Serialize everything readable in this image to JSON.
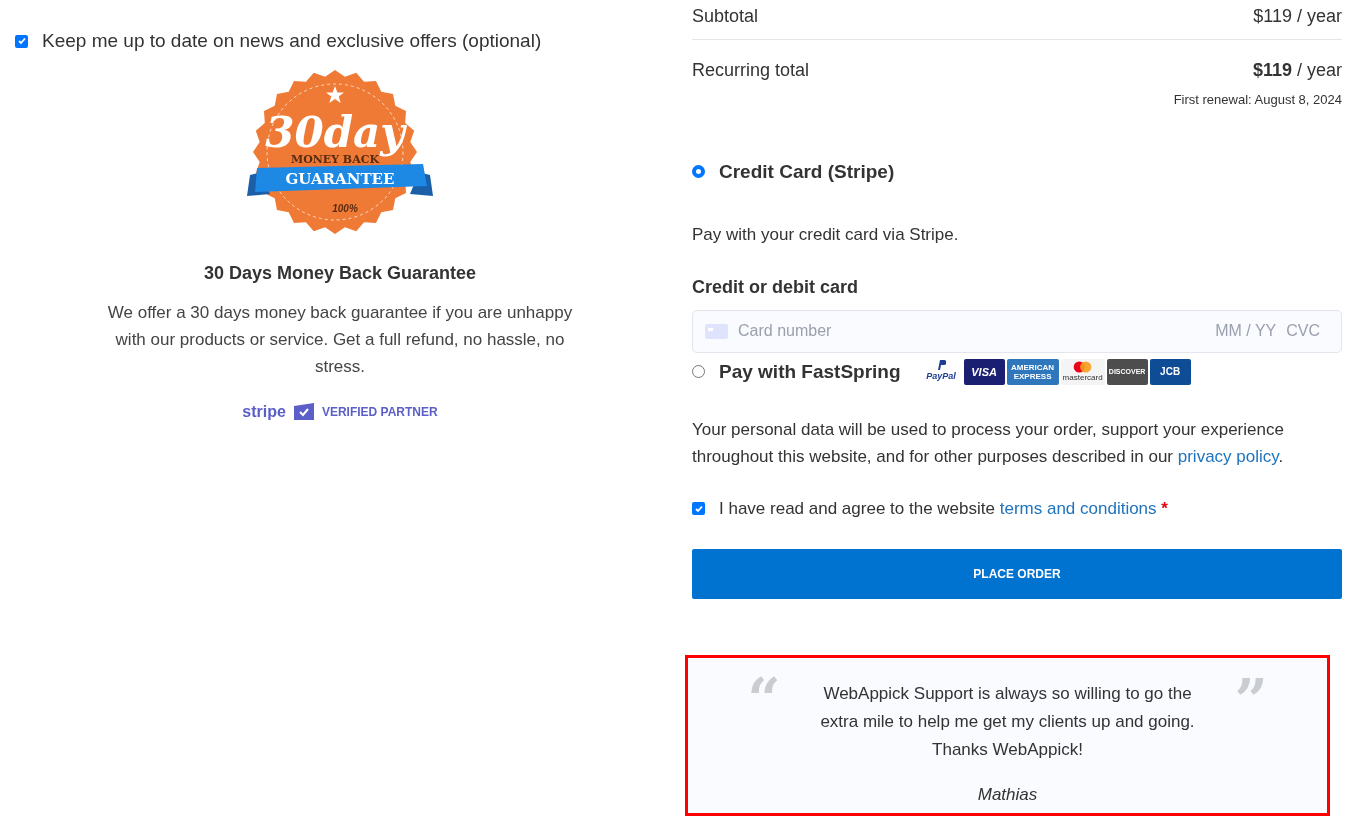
{
  "newsletter": {
    "label": "Keep me up to date on news and exclusive offers (optional)",
    "checked": true
  },
  "badge": {
    "big": "30day",
    "line": "MONEY BACK",
    "ribbon": "GUARANTEE",
    "percent": "100%"
  },
  "guarantee": {
    "title": "30 Days Money Back Guarantee",
    "text": "We offer a 30 days money back guarantee if you are unhappy with our products or service. Get a full refund, no hassle, no stress."
  },
  "stripe_badge": {
    "brand": "stripe",
    "label": "VERIFIED PARTNER"
  },
  "totals": [
    {
      "label": "Subtotal",
      "amount": "$119",
      "period": " / year",
      "bold": false
    },
    {
      "label": "Recurring total",
      "amount": "$119",
      "period": " / year",
      "bold": true
    }
  ],
  "renewal": "First renewal: August 8, 2024",
  "payment_methods": [
    {
      "kind": "stripe",
      "label": "Credit Card (Stripe)",
      "selected": true,
      "description": "Pay with your credit card via Stripe.",
      "card_heading": "Credit or debit card",
      "card_placeholder": "Card number",
      "expiry_placeholder": "MM / YY",
      "cvc_placeholder": "CVC"
    },
    {
      "kind": "fastspring",
      "label": "Pay with FastSpring",
      "selected": false,
      "logos": [
        {
          "kind": "paypal",
          "text": "PayPal"
        },
        {
          "kind": "visa",
          "text": "VISA"
        },
        {
          "kind": "amex",
          "text": "AMERICAN EXPRESS"
        },
        {
          "kind": "mastercard",
          "text": "mastercard"
        },
        {
          "kind": "discover",
          "text": "DISCOVER"
        },
        {
          "kind": "jcb",
          "text": "JCB"
        }
      ]
    }
  ],
  "privacy": {
    "text": "Your personal data will be used to process your order, support your experience throughout this website, and for other purposes described in our ",
    "link": "privacy policy",
    "end": "."
  },
  "terms": {
    "text": "I have read and agree to the website ",
    "link": "terms and conditions",
    "required": "*",
    "checked": true
  },
  "place_order": "PLACE ORDER",
  "testimonial": {
    "open_quote": "“",
    "close_quote": "”",
    "text": "WebAppick Support is always so willing to go the extra mile to help me get my clients up and going. Thanks WebAppick!",
    "author": "Mathias"
  }
}
